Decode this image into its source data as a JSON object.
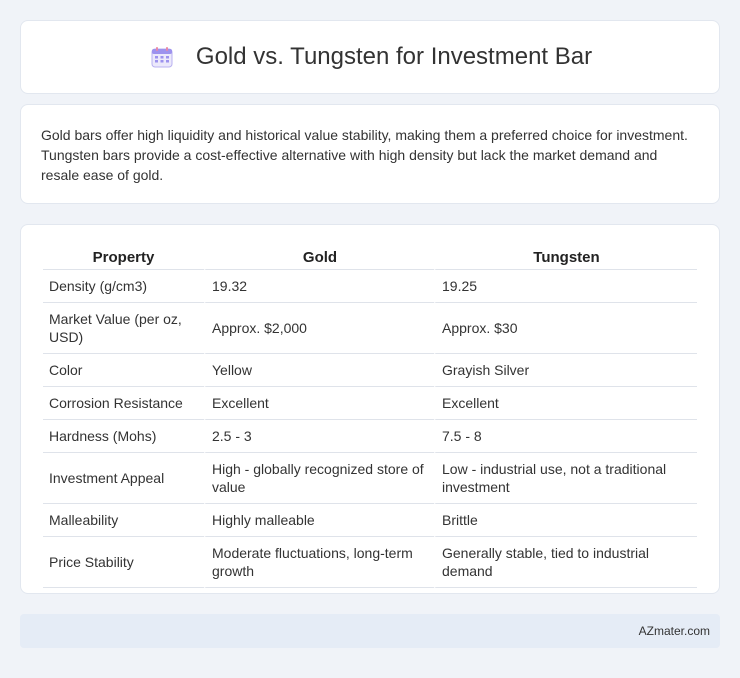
{
  "header": {
    "title": "Gold vs. Tungsten for Investment Bar",
    "icon": "calendar-icon"
  },
  "intro": {
    "text": "Gold bars offer high liquidity and historical value stability, making them a preferred choice for investment. Tungsten bars provide a cost-effective alternative with high density but lack the market demand and resale ease of gold."
  },
  "table": {
    "headers": [
      "Property",
      "Gold",
      "Tungsten"
    ],
    "rows": [
      [
        "Density (g/cm3)",
        "19.32",
        "19.25"
      ],
      [
        "Market Value (per oz, USD)",
        "Approx. $2,000",
        "Approx. $30"
      ],
      [
        "Color",
        "Yellow",
        "Grayish Silver"
      ],
      [
        "Corrosion Resistance",
        "Excellent",
        "Excellent"
      ],
      [
        "Hardness (Mohs)",
        "2.5 - 3",
        "7.5 - 8"
      ],
      [
        "Investment Appeal",
        "High - globally recognized store of value",
        "Low - industrial use, not a traditional investment"
      ],
      [
        "Malleability",
        "Highly malleable",
        "Brittle"
      ],
      [
        "Price Stability",
        "Moderate fluctuations, long-term growth",
        "Generally stable, tied to industrial demand"
      ]
    ]
  },
  "footer": {
    "text": "AZmater.com"
  },
  "colors": {
    "background": "#f0f3f8",
    "card": "#ffffff",
    "footer": "#e5ecf6",
    "icon_accent": "#8a7de8"
  }
}
